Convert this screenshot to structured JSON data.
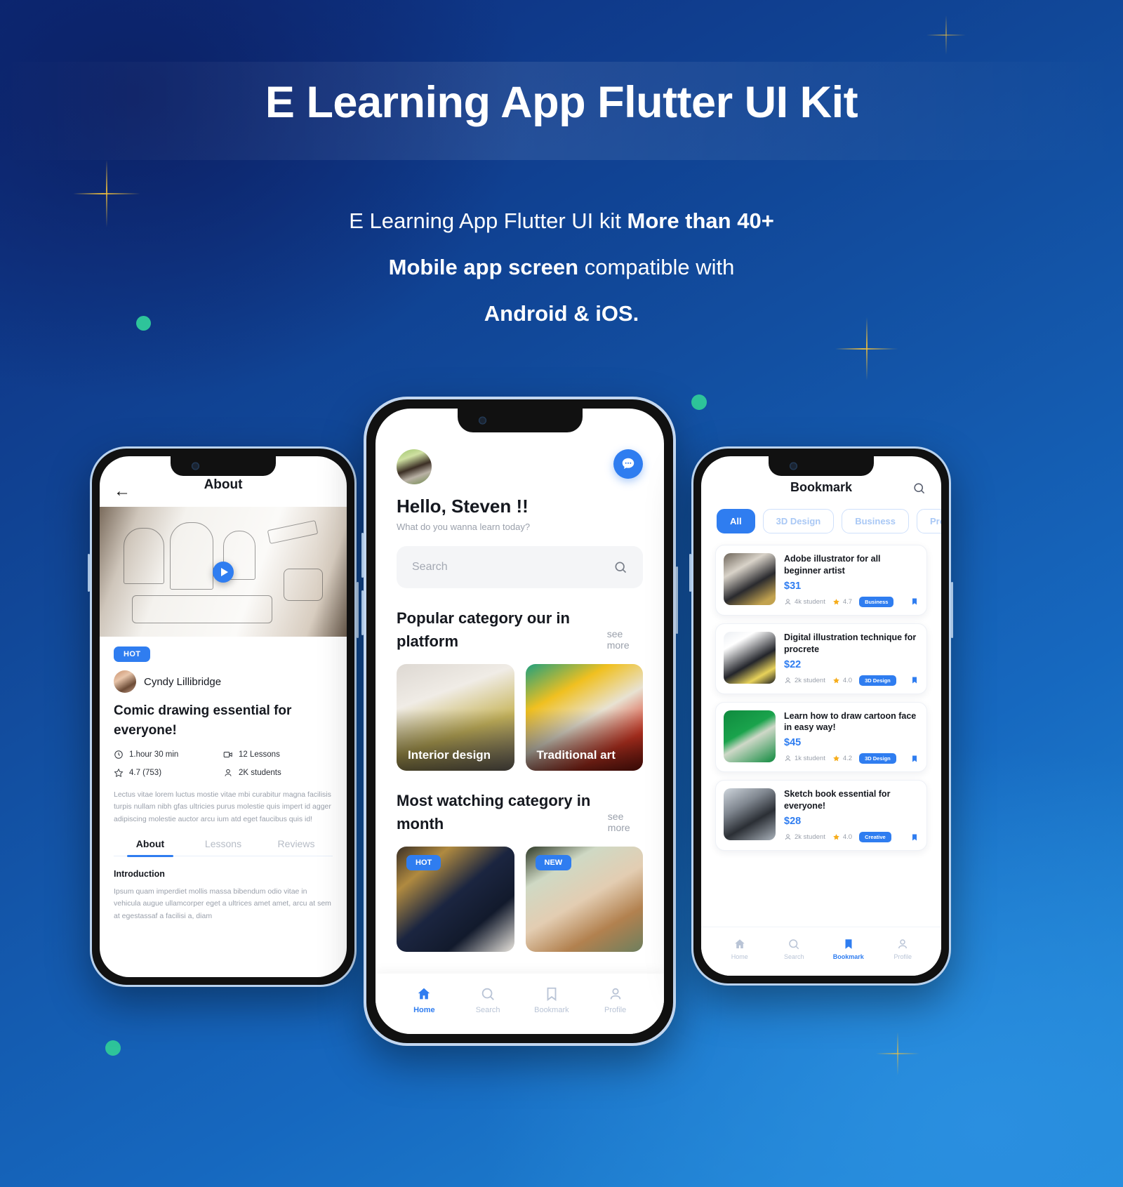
{
  "hero": {
    "title": "E Learning App Flutter UI Kit",
    "subtitle_line1_plain": "E Learning App Flutter UI kit ",
    "subtitle_line1_bold": "More than 40+",
    "subtitle_line2_bold": "Mobile app screen",
    "subtitle_line2_plain": " compatible with",
    "subtitle_line3_bold": "Android & iOS."
  },
  "colors": {
    "accent": "#2f7df0",
    "star": "#f6ad1c",
    "sparkle": "#f5c33b",
    "dot": "#2ec49a",
    "muted": "#9aa0ab"
  },
  "about_screen": {
    "appbar_title": "About",
    "back_icon": "arrow-left-icon",
    "play_icon": "play-icon",
    "badge": "HOT",
    "author": "Cyndy Lillibridge",
    "course_title": "Comic drawing essential for everyone!",
    "meta": [
      {
        "icon": "clock-icon",
        "label": "1.hour 30 min"
      },
      {
        "icon": "video-icon",
        "label": "12 Lessons"
      },
      {
        "icon": "star-outline-icon",
        "label": "4.7  (753)"
      },
      {
        "icon": "person-icon",
        "label": "2K  students"
      }
    ],
    "description": "Lectus vitae lorem luctus mostie vitae mbi curabitur magna facilisis turpis nullam nibh gfas ultricies purus molestie quis impert id agger adipiscing molestie auctor arcu ium  atd eget faucibus quis id!",
    "tabs": [
      {
        "label": "About",
        "active": true
      },
      {
        "label": "Lessons",
        "active": false
      },
      {
        "label": "Reviews",
        "active": false
      }
    ],
    "intro_heading": "Introduction",
    "intro_body": "Ipsum quam imperdiet mollis massa bibendum odio vitae in vehicula augue ullamcorper eget a ultrices amet amet, arcu at sem at egestassaf a  facilisi a, diam"
  },
  "home_screen": {
    "avatar": "user-avatar",
    "chat_icon": "chat-bubble-icon",
    "greeting": "Hello, Steven !!",
    "greeting_sub": "What do you wanna learn today?",
    "search_placeholder": "Search",
    "search_icon": "search-icon",
    "popular": {
      "title": "Popular category our  in platform",
      "see_more": "see more",
      "cards": [
        {
          "label": "Interior design"
        },
        {
          "label": "Traditional art"
        }
      ]
    },
    "most_watching": {
      "title": "Most watching category in month",
      "see_more": "see more",
      "cards": [
        {
          "tag": "HOT"
        },
        {
          "tag": "NEW"
        }
      ]
    },
    "nav": [
      {
        "icon": "home-icon",
        "label": "Home",
        "active": true
      },
      {
        "icon": "search-icon",
        "label": "Search",
        "active": false
      },
      {
        "icon": "bookmark-icon",
        "label": "Bookmark",
        "active": false
      },
      {
        "icon": "profile-icon",
        "label": "Profile",
        "active": false
      }
    ]
  },
  "bookmark_screen": {
    "title": "Bookmark",
    "search_icon": "search-icon",
    "filters": [
      {
        "label": "All",
        "active": true
      },
      {
        "label": "3D Design",
        "active": false
      },
      {
        "label": "Business",
        "active": false
      },
      {
        "label": "Programming",
        "active": false
      }
    ],
    "cards": [
      {
        "name": "Adobe illustrator for all beginner artist",
        "price": "$31",
        "students": "4k student",
        "rating": "4.7",
        "category": "Business",
        "thumb_class": "t1"
      },
      {
        "name": "Digital illustration technique for procrete",
        "price": "$22",
        "students": "2k student",
        "rating": "4.0",
        "category": "3D Design",
        "thumb_class": "t2"
      },
      {
        "name": "Learn how to draw cartoon face in easy way!",
        "price": "$45",
        "students": "1k student",
        "rating": "4.2",
        "category": "3D Design",
        "thumb_class": "t3"
      },
      {
        "name": "Sketch book essential for everyone!",
        "price": "$28",
        "students": "2k student",
        "rating": "4.0",
        "category": "Creative",
        "thumb_class": "t4"
      }
    ],
    "nav": [
      {
        "icon": "home-icon",
        "label": "Home",
        "active": false
      },
      {
        "icon": "search-icon",
        "label": "Search",
        "active": false
      },
      {
        "icon": "bookmark-icon",
        "label": "Bookmark",
        "active": true
      },
      {
        "icon": "profile-icon",
        "label": "Profile",
        "active": false
      }
    ]
  }
}
